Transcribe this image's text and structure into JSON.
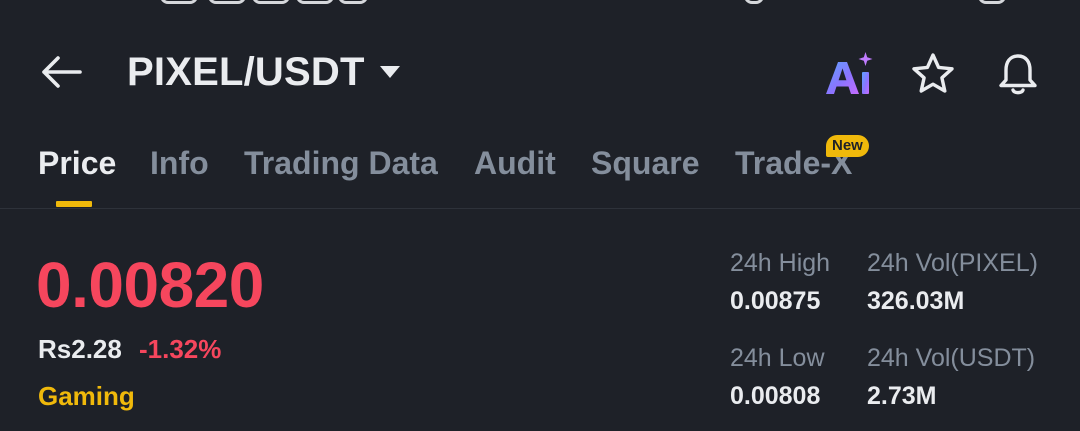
{
  "header": {
    "pair": "PIXEL/USDT",
    "icons": [
      "back-arrow-icon",
      "caret-down-icon",
      "ai-icon",
      "star-icon",
      "bell-icon"
    ]
  },
  "tabs": [
    {
      "label": "Price",
      "active": true
    },
    {
      "label": "Info"
    },
    {
      "label": "Trading Data"
    },
    {
      "label": "Audit"
    },
    {
      "label": "Square"
    },
    {
      "label": "Trade-X",
      "badge": "New"
    }
  ],
  "ticker": {
    "price": "0.00820",
    "fiat_price": "Rs2.28",
    "change": "-1.32%",
    "tag": "Gaming"
  },
  "stats": {
    "high_label": "24h High",
    "high_value": "0.00875",
    "low_label": "24h Low",
    "low_value": "0.00808",
    "vol_base_label": "24h Vol(PIXEL)",
    "vol_base_value": "326.03M",
    "vol_quote_label": "24h Vol(USDT)",
    "vol_quote_value": "2.73M"
  },
  "colors": {
    "background": "#1e2128",
    "accent": "#f0b90b",
    "negative": "#f6465d",
    "muted": "#848e9c",
    "text": "#eaecef"
  }
}
